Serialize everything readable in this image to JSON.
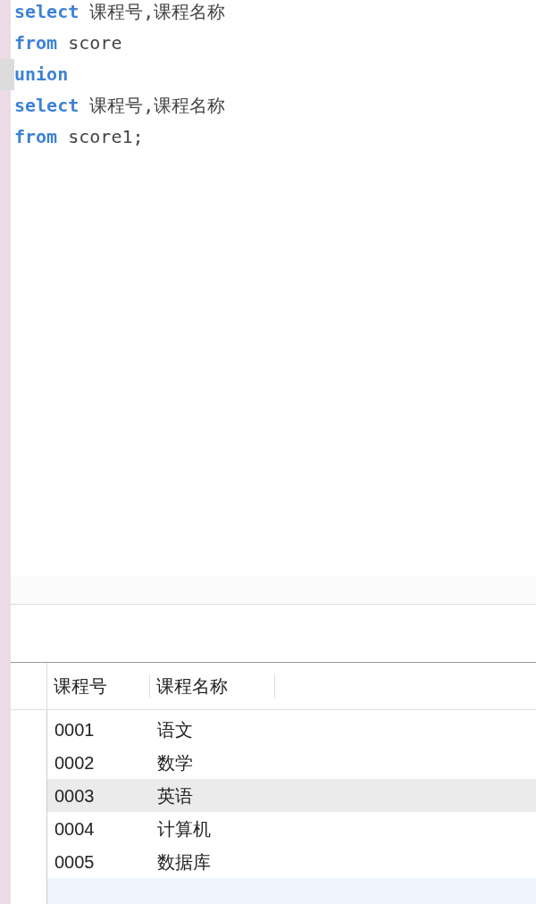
{
  "editor": {
    "lines": [
      {
        "current": false,
        "tokens": [
          {
            "kind": "keyword",
            "text": "select"
          },
          {
            "kind": "text",
            "text": "课程号,课程名称"
          }
        ]
      },
      {
        "current": false,
        "tokens": [
          {
            "kind": "keyword",
            "text": "from"
          },
          {
            "kind": "text",
            "text": "score"
          }
        ]
      },
      {
        "current": true,
        "tokens": [
          {
            "kind": "keyword",
            "text": "union"
          }
        ]
      },
      {
        "current": false,
        "tokens": [
          {
            "kind": "keyword",
            "text": "select"
          },
          {
            "kind": "text",
            "text": "课程号,课程名称"
          }
        ]
      },
      {
        "current": false,
        "tokens": [
          {
            "kind": "keyword",
            "text": "from"
          },
          {
            "kind": "text",
            "text": "score1;"
          }
        ]
      }
    ]
  },
  "results": {
    "columns": [
      "课程号",
      "课程名称"
    ],
    "rows": [
      {
        "selected": false,
        "cells": [
          "0001",
          "语文"
        ]
      },
      {
        "selected": false,
        "cells": [
          "0002",
          "数学"
        ]
      },
      {
        "selected": true,
        "cells": [
          "0003",
          "英语"
        ]
      },
      {
        "selected": false,
        "cells": [
          "0004",
          "计算机"
        ]
      },
      {
        "selected": false,
        "cells": [
          "0005",
          "数据库"
        ]
      }
    ]
  }
}
